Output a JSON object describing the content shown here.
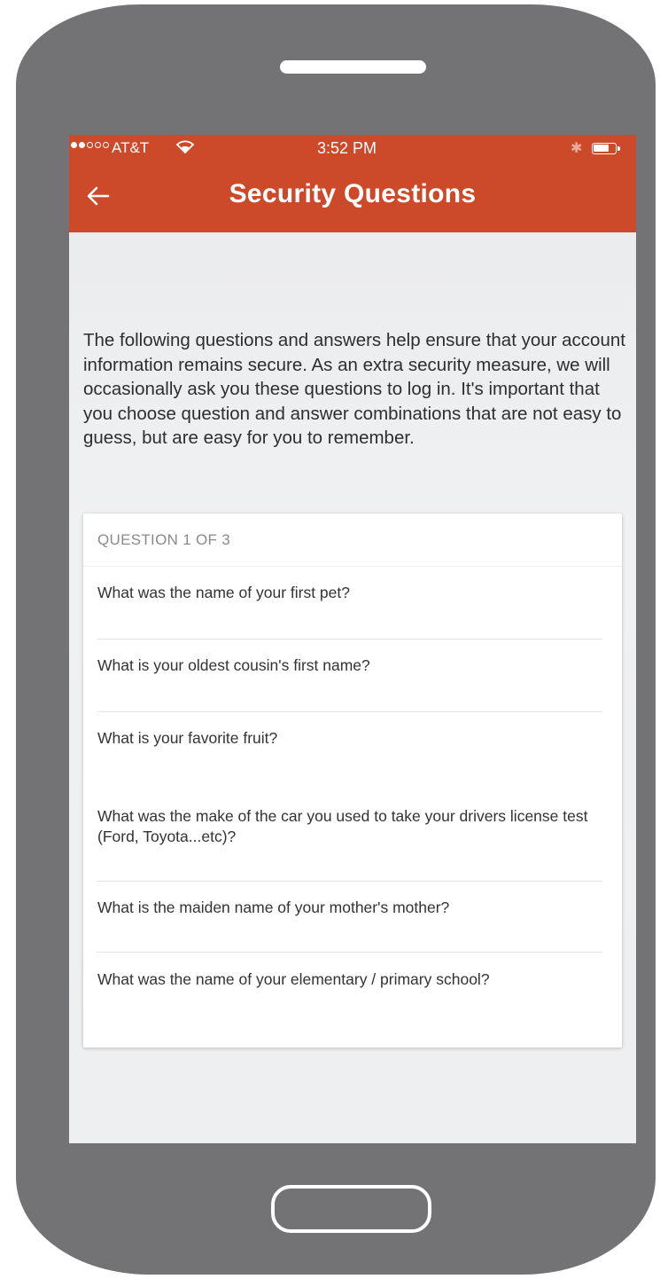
{
  "status_bar": {
    "carrier": "AT&T",
    "time": "3:52 PM",
    "signal_bars": 2,
    "signal_total": 5,
    "battery_level": 0.75
  },
  "header": {
    "title": "Security Questions",
    "back_icon": "arrow-left-icon"
  },
  "intro": {
    "text": "The following questions and answers help ensure that your account information remains secure. As an extra security measure, we will occasionally ask you these questions to log in. It's important that you choose question and answer combinations that are not easy to guess, but are easy for you to remember."
  },
  "card": {
    "header": "QUESTION 1 OF 3",
    "questions": [
      "What was the name of your first pet?",
      "What is your oldest cousin's first name?",
      "What is your favorite fruit?",
      "What was the make of the car you used to take your drivers license test (Ford, Toyota...etc)?",
      "What is the maiden name of your mother's mother?",
      "What was the name of your elementary / primary school?"
    ]
  },
  "colors": {
    "app_bar": "#cc4a2a",
    "device_body": "#737275",
    "screen_background": "#eeeff0"
  }
}
